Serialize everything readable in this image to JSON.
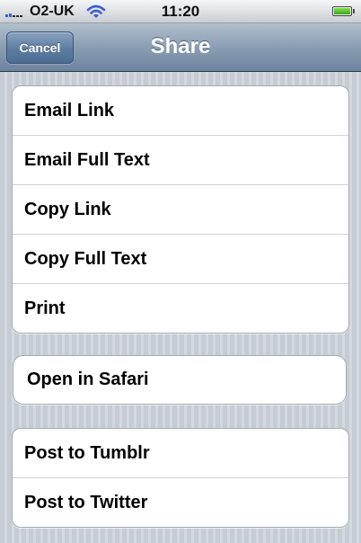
{
  "status_bar": {
    "carrier": "O2-UK",
    "time": "11:20",
    "signal_bars_active": 2,
    "battery_level_percent": 100,
    "icons": [
      "signal-icon",
      "wifi-icon",
      "battery-icon"
    ]
  },
  "nav": {
    "title": "Share",
    "cancel_label": "Cancel"
  },
  "groups": [
    {
      "items": [
        "Email Link",
        "Email Full Text",
        "Copy Link",
        "Copy Full Text",
        "Print"
      ]
    },
    {
      "items": [
        "Open in Safari"
      ]
    },
    {
      "items": [
        "Post to Tumblr",
        "Post to Twitter"
      ]
    }
  ],
  "colors": {
    "nav_bar": "#8a9eb3",
    "cancel_button": "#5e7ca2",
    "background_stripes": "#c5ccd3",
    "cell_background": "#ffffff"
  }
}
